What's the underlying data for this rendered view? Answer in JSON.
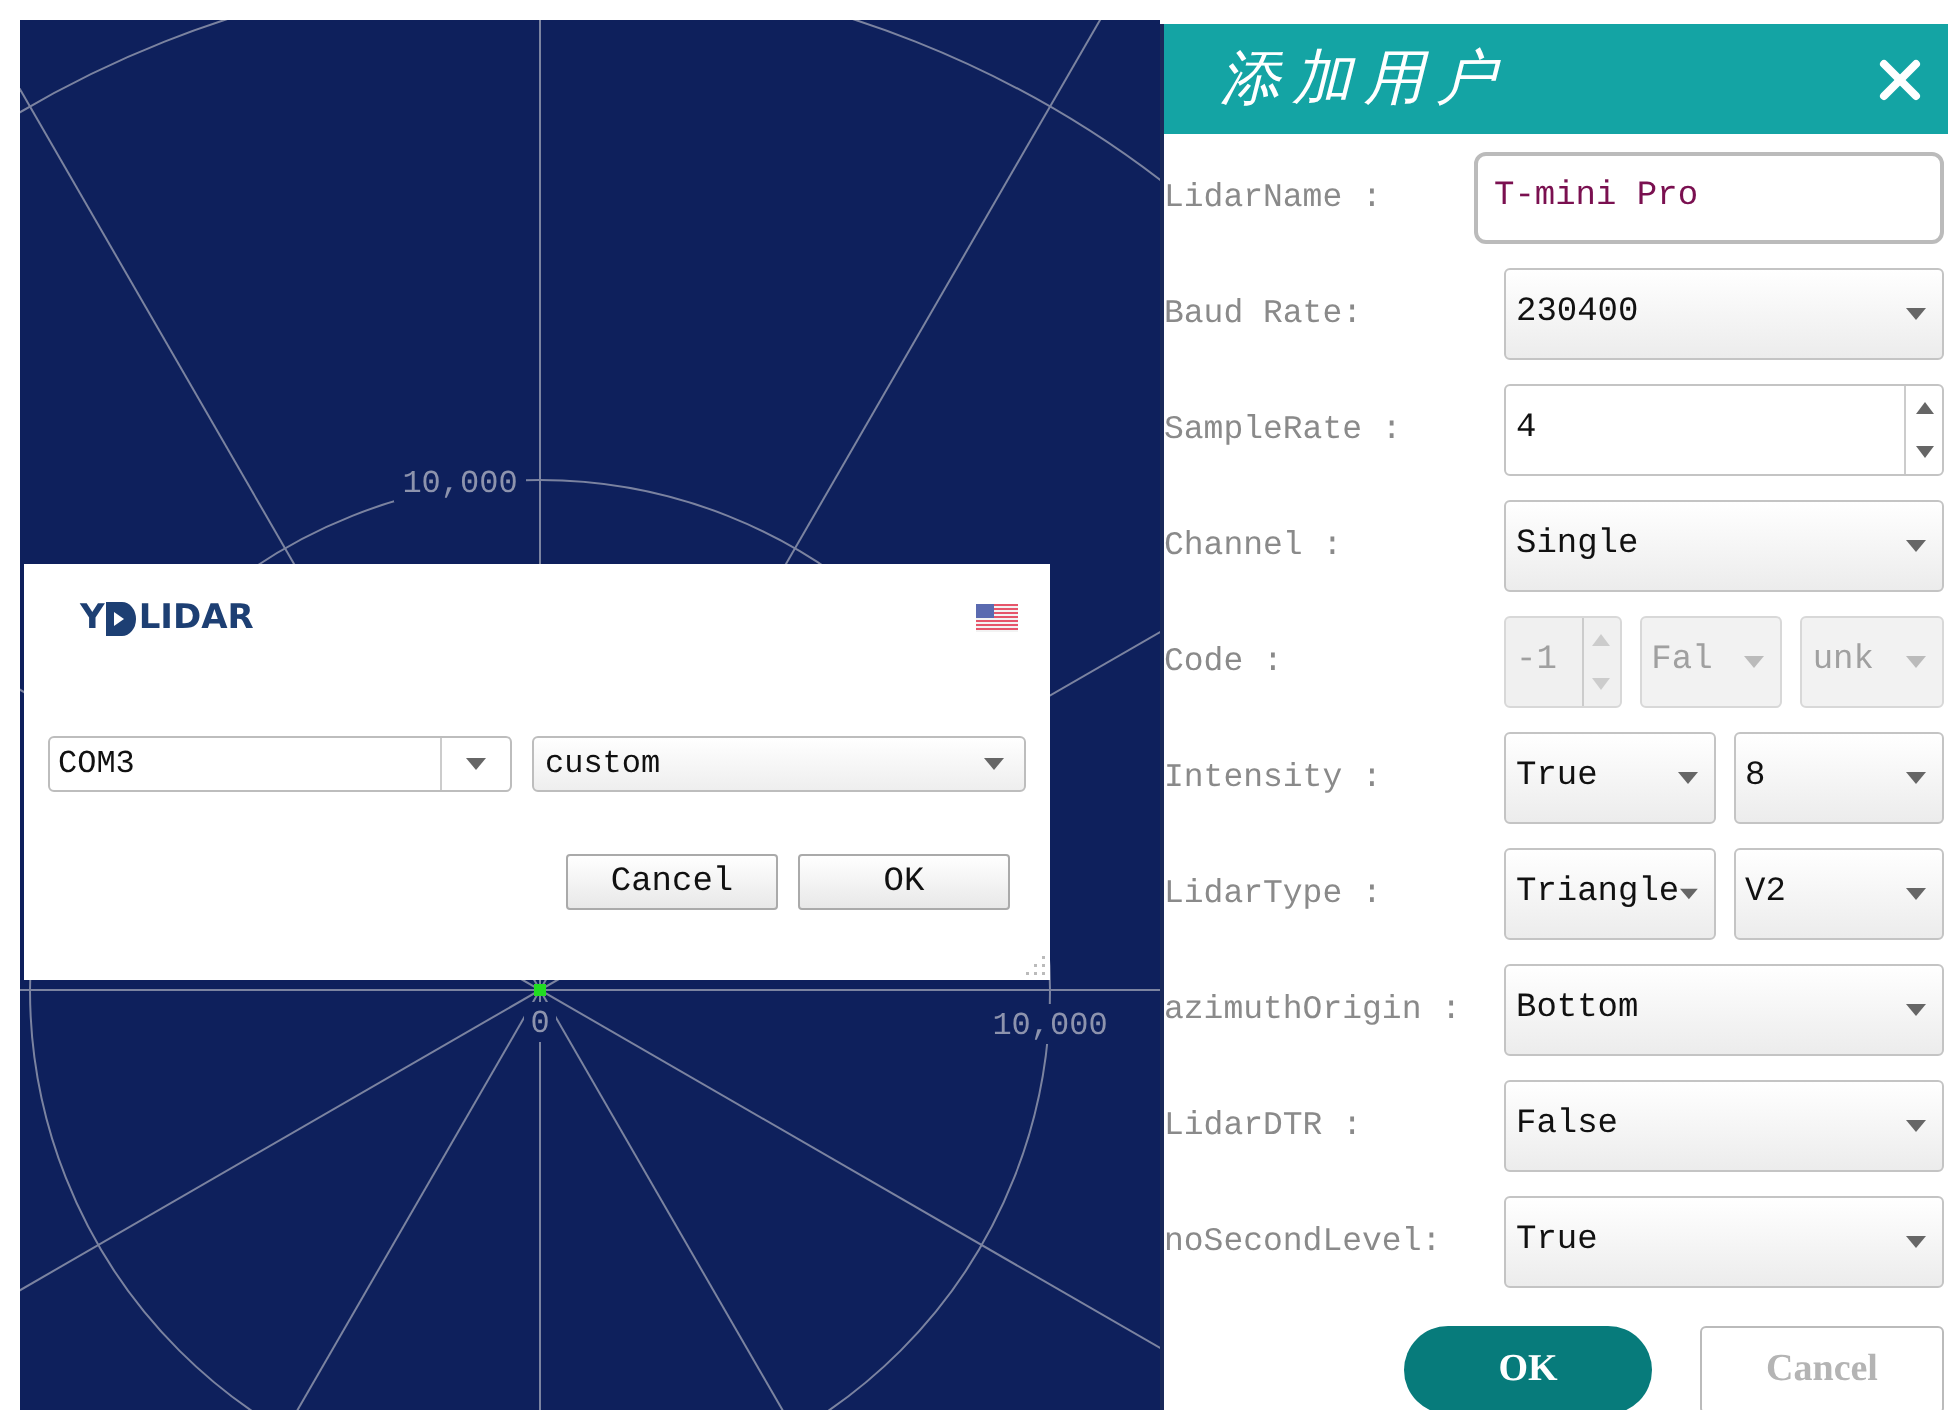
{
  "polar_plot": {
    "labels": [
      {
        "kind": "ring",
        "text": "10,000"
      },
      {
        "kind": "origin",
        "text": "0"
      },
      {
        "kind": "axis",
        "text": "10,000"
      }
    ],
    "point": {
      "color": "#22dd22"
    }
  },
  "connect_dialog": {
    "logo_left": "Y",
    "logo_right": "LIDAR",
    "port": "COM3",
    "mode": "custom",
    "buttons": [
      "Cancel",
      "OK"
    ]
  },
  "panel": {
    "title": "添加用户",
    "rows": [
      {
        "label": "LidarName :",
        "controls": [
          {
            "kind": "text",
            "value": "T-mini Pro"
          }
        ]
      },
      {
        "label": "Baud Rate:",
        "controls": [
          {
            "kind": "select",
            "value": "230400",
            "disabled": false
          }
        ]
      },
      {
        "label": "SampleRate :",
        "controls": [
          {
            "kind": "spin",
            "value": "4",
            "disabled": false
          }
        ]
      },
      {
        "label": "Channel :",
        "controls": [
          {
            "kind": "select",
            "value": "Single",
            "disabled": false
          }
        ]
      },
      {
        "label": "Code :",
        "controls": [
          {
            "kind": "spin",
            "value": "-1",
            "disabled": true
          },
          {
            "kind": "select",
            "value": "Fal",
            "disabled": true
          },
          {
            "kind": "select",
            "value": "unk",
            "disabled": true
          }
        ]
      },
      {
        "label": "Intensity :",
        "controls": [
          {
            "kind": "select",
            "value": "True",
            "disabled": false
          },
          {
            "kind": "select",
            "value": "8",
            "disabled": false
          }
        ]
      },
      {
        "label": "LidarType :",
        "controls": [
          {
            "kind": "select",
            "value": "Triangle",
            "disabled": false
          },
          {
            "kind": "select",
            "value": "V2",
            "disabled": false
          }
        ]
      },
      {
        "label": "azimuthOrigin :",
        "controls": [
          {
            "kind": "select",
            "value": "Bottom",
            "disabled": false
          }
        ]
      },
      {
        "label": "LidarDTR :",
        "controls": [
          {
            "kind": "select",
            "value": "False",
            "disabled": false
          }
        ]
      },
      {
        "label": "noSecondLevel:",
        "controls": [
          {
            "kind": "select",
            "value": "True",
            "disabled": false
          }
        ]
      }
    ],
    "buttons": [
      {
        "label": "OK",
        "kind": "primary"
      },
      {
        "label": "Cancel",
        "kind": "secondary",
        "disabled": true
      }
    ]
  }
}
